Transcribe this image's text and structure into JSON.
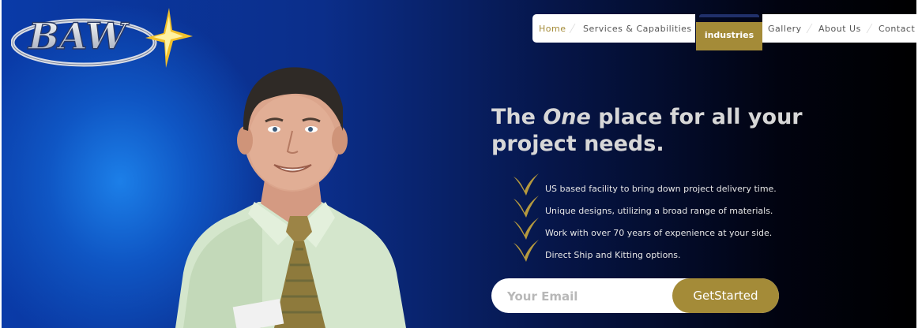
{
  "brand": {
    "logo_text": "BAW",
    "accent_color": "#a48b38"
  },
  "nav": {
    "items": [
      {
        "label": "Home",
        "active": true
      },
      {
        "label": "Services & Capabilities",
        "active": false
      },
      {
        "label": "industries",
        "active": false,
        "highlighted": true
      },
      {
        "label": "Gallery",
        "active": false
      },
      {
        "label": "About Us",
        "active": false
      },
      {
        "label": "Contact",
        "active": false
      }
    ]
  },
  "hero": {
    "headline_pre": "The ",
    "headline_em": "One",
    "headline_post": " place for all your project needs.",
    "features": [
      "US based facility to bring down project delivery time.",
      "Unique designs, utilizing a broad range of materials.",
      "Work with over 70 years of expenience at your side.",
      "Direct Ship and Kitting options."
    ],
    "feature_icon": "gold-checkmark-icon"
  },
  "signup": {
    "email_placeholder": "Your Email",
    "email_value": "",
    "button_label": "GetStarted"
  }
}
